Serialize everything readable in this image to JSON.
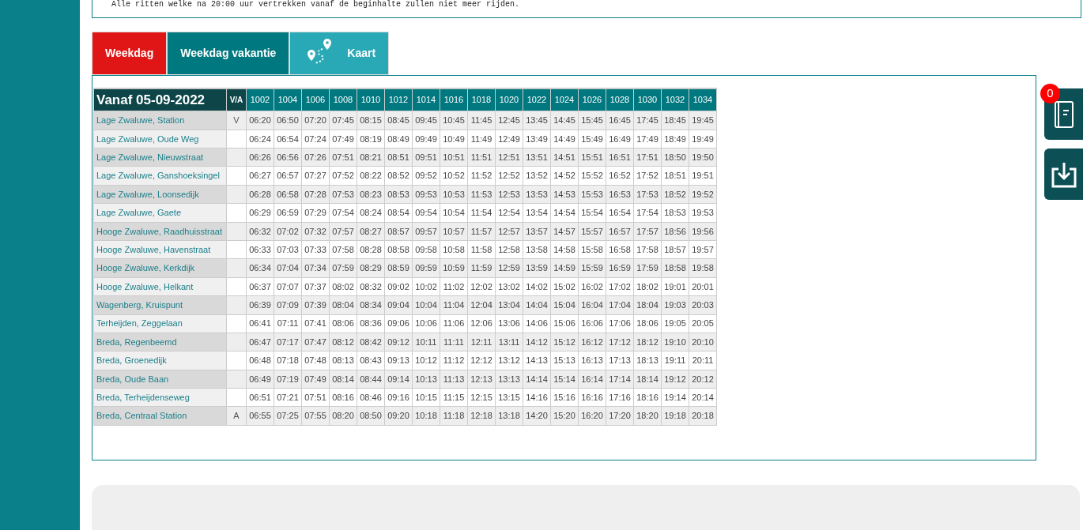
{
  "notice": "Alle ritten welke na 20:00 uur vertrekken vanaf de beginhalte zullen niet meer rijden.",
  "tabs": [
    {
      "label": "Weekdag",
      "kind": "text",
      "selected": true
    },
    {
      "label": "Weekdag vakantie",
      "kind": "text",
      "selected": false
    },
    {
      "label": "Kaart",
      "kind": "map",
      "selected": false
    }
  ],
  "table": {
    "title": "Vanaf 05-09-2022",
    "va_heading": "V/A",
    "columns": [
      "1002",
      "1004",
      "1006",
      "1008",
      "1010",
      "1012",
      "1014",
      "1016",
      "1018",
      "1020",
      "1022",
      "1024",
      "1026",
      "1028",
      "1030",
      "1032",
      "1034"
    ],
    "rows": [
      {
        "stop": "Lage Zwaluwe, Station",
        "va": "V",
        "times": [
          "06:20",
          "06:50",
          "07:20",
          "07:45",
          "08:15",
          "08:45",
          "09:45",
          "10:45",
          "11:45",
          "12:45",
          "13:45",
          "14:45",
          "15:45",
          "16:45",
          "17:45",
          "18:45",
          "19:45"
        ]
      },
      {
        "stop": "Lage Zwaluwe, Oude Weg",
        "times": [
          "06:24",
          "06:54",
          "07:24",
          "07:49",
          "08:19",
          "08:49",
          "09:49",
          "10:49",
          "11:49",
          "12:49",
          "13:49",
          "14:49",
          "15:49",
          "16:49",
          "17:49",
          "18:49",
          "19:49"
        ]
      },
      {
        "stop": "Lage Zwaluwe, Nieuwstraat",
        "times": [
          "06:26",
          "06:56",
          "07:26",
          "07:51",
          "08:21",
          "08:51",
          "09:51",
          "10:51",
          "11:51",
          "12:51",
          "13:51",
          "14:51",
          "15:51",
          "16:51",
          "17:51",
          "18:50",
          "19:50"
        ]
      },
      {
        "stop": "Lage Zwaluwe, Ganshoeksingel",
        "times": [
          "06:27",
          "06:57",
          "07:27",
          "07:52",
          "08:22",
          "08:52",
          "09:52",
          "10:52",
          "11:52",
          "12:52",
          "13:52",
          "14:52",
          "15:52",
          "16:52",
          "17:52",
          "18:51",
          "19:51"
        ]
      },
      {
        "stop": "Lage Zwaluwe, Loonsedijk",
        "times": [
          "06:28",
          "06:58",
          "07:28",
          "07:53",
          "08:23",
          "08:53",
          "09:53",
          "10:53",
          "11:53",
          "12:53",
          "13:53",
          "14:53",
          "15:53",
          "16:53",
          "17:53",
          "18:52",
          "19:52"
        ]
      },
      {
        "stop": "Lage Zwaluwe, Gaete",
        "times": [
          "06:29",
          "06:59",
          "07:29",
          "07:54",
          "08:24",
          "08:54",
          "09:54",
          "10:54",
          "11:54",
          "12:54",
          "13:54",
          "14:54",
          "15:54",
          "16:54",
          "17:54",
          "18:53",
          "19:53"
        ]
      },
      {
        "stop": "Hooge Zwaluwe, Raadhuisstraat",
        "times": [
          "06:32",
          "07:02",
          "07:32",
          "07:57",
          "08:27",
          "08:57",
          "09:57",
          "10:57",
          "11:57",
          "12:57",
          "13:57",
          "14:57",
          "15:57",
          "16:57",
          "17:57",
          "18:56",
          "19:56"
        ]
      },
      {
        "stop": "Hooge Zwaluwe, Havenstraat",
        "times": [
          "06:33",
          "07:03",
          "07:33",
          "07:58",
          "08:28",
          "08:58",
          "09:58",
          "10:58",
          "11:58",
          "12:58",
          "13:58",
          "14:58",
          "15:58",
          "16:58",
          "17:58",
          "18:57",
          "19:57"
        ]
      },
      {
        "stop": "Hooge Zwaluwe, Kerkdijk",
        "times": [
          "06:34",
          "07:04",
          "07:34",
          "07:59",
          "08:29",
          "08:59",
          "09:59",
          "10:59",
          "11:59",
          "12:59",
          "13:59",
          "14:59",
          "15:59",
          "16:59",
          "17:59",
          "18:58",
          "19:58"
        ]
      },
      {
        "stop": "Hooge Zwaluwe, Helkant",
        "times": [
          "06:37",
          "07:07",
          "07:37",
          "08:02",
          "08:32",
          "09:02",
          "10:02",
          "11:02",
          "12:02",
          "13:02",
          "14:02",
          "15:02",
          "16:02",
          "17:02",
          "18:02",
          "19:01",
          "20:01"
        ]
      },
      {
        "stop": "Wagenberg, Kruispunt",
        "times": [
          "06:39",
          "07:09",
          "07:39",
          "08:04",
          "08:34",
          "09:04",
          "10:04",
          "11:04",
          "12:04",
          "13:04",
          "14:04",
          "15:04",
          "16:04",
          "17:04",
          "18:04",
          "19:03",
          "20:03"
        ]
      },
      {
        "stop": "Terheijden, Zeggelaan",
        "times": [
          "06:41",
          "07:11",
          "07:41",
          "08:06",
          "08:36",
          "09:06",
          "10:06",
          "11:06",
          "12:06",
          "13:06",
          "14:06",
          "15:06",
          "16:06",
          "17:06",
          "18:06",
          "19:05",
          "20:05"
        ]
      },
      {
        "stop": "Breda, Regenbeemd",
        "times": [
          "06:47",
          "07:17",
          "07:47",
          "08:12",
          "08:42",
          "09:12",
          "10:11",
          "11:11",
          "12:11",
          "13:11",
          "14:12",
          "15:12",
          "16:12",
          "17:12",
          "18:12",
          "19:10",
          "20:10"
        ]
      },
      {
        "stop": "Breda, Groenedijk",
        "times": [
          "06:48",
          "07:18",
          "07:48",
          "08:13",
          "08:43",
          "09:13",
          "10:12",
          "11:12",
          "12:12",
          "13:12",
          "14:13",
          "15:13",
          "16:13",
          "17:13",
          "18:13",
          "19:11",
          "20:11"
        ]
      },
      {
        "stop": "Breda, Oude Baan",
        "times": [
          "06:49",
          "07:19",
          "07:49",
          "08:14",
          "08:44",
          "09:14",
          "10:13",
          "11:13",
          "12:13",
          "13:13",
          "14:14",
          "15:14",
          "16:14",
          "17:14",
          "18:14",
          "19:12",
          "20:12"
        ]
      },
      {
        "stop": "Breda, Terheijdenseweg",
        "times": [
          "06:51",
          "07:21",
          "07:51",
          "08:16",
          "08:46",
          "09:16",
          "10:15",
          "11:15",
          "12:15",
          "13:15",
          "14:16",
          "15:16",
          "16:16",
          "17:16",
          "18:16",
          "19:14",
          "20:14"
        ]
      },
      {
        "stop": "Breda, Centraal Station",
        "va": "A",
        "times": [
          "06:55",
          "07:25",
          "07:55",
          "08:20",
          "08:50",
          "09:20",
          "10:18",
          "11:18",
          "12:18",
          "13:18",
          "14:20",
          "15:20",
          "16:20",
          "17:20",
          "18:20",
          "19:18",
          "20:18"
        ]
      }
    ]
  },
  "side_buttons": [
    {
      "kind": "booklet",
      "badge": "0"
    },
    {
      "kind": "download"
    }
  ]
}
